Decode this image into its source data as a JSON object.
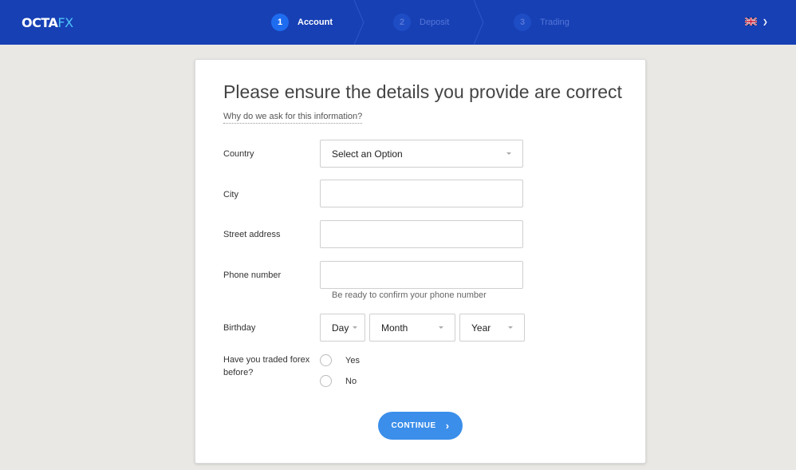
{
  "header": {
    "logo_part1": "OCTA",
    "logo_part2": "FX",
    "steps": [
      {
        "number": "1",
        "label": "Account",
        "state": "active"
      },
      {
        "number": "2",
        "label": "Deposit",
        "state": "inactive"
      },
      {
        "number": "3",
        "label": "Trading",
        "state": "inactive"
      }
    ],
    "language_icon": "uk-flag-icon"
  },
  "form": {
    "title": "Please ensure the details you provide are correct",
    "why_link": "Why do we ask for this information?",
    "country": {
      "label": "Country",
      "value": "Select an Option"
    },
    "city": {
      "label": "City",
      "value": ""
    },
    "street": {
      "label": "Street address",
      "value": ""
    },
    "phone": {
      "label": "Phone number",
      "value": "",
      "hint": "Be ready to confirm your phone number"
    },
    "birthday": {
      "label": "Birthday",
      "day": "Day",
      "month": "Month",
      "year": "Year"
    },
    "forex": {
      "label_line1": "Have you traded forex",
      "label_line2": "before?",
      "options": [
        "Yes",
        "No"
      ]
    },
    "continue_label": "CONTINUE",
    "continue_icon": "chevron-right-icon"
  }
}
